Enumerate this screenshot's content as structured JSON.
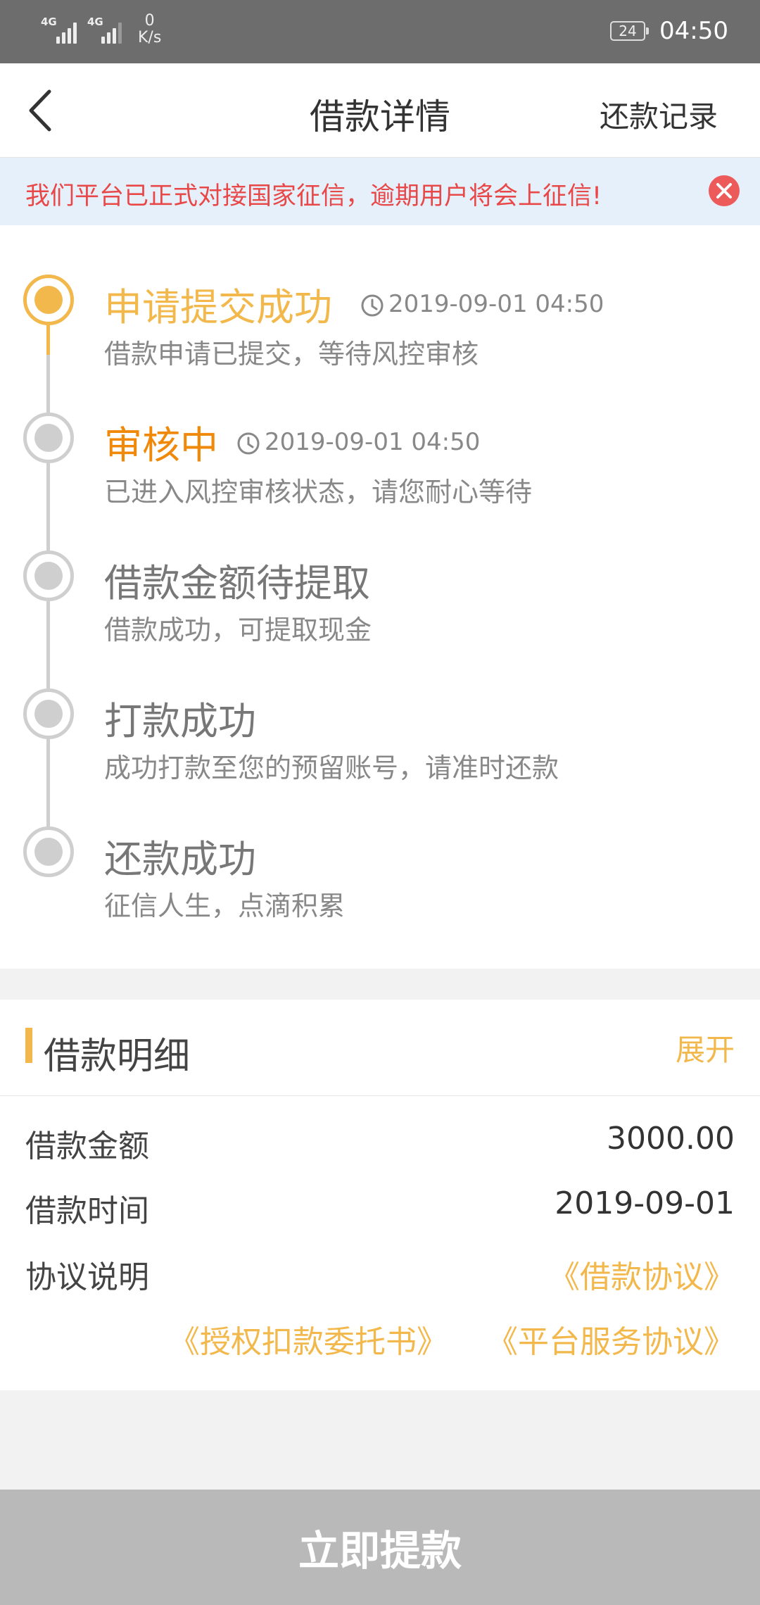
{
  "status_bar": {
    "sim1_tag": "4G",
    "sim2_tag": "4G",
    "net_speed_value": "0",
    "net_speed_unit": "K/s",
    "battery": "24",
    "time": "04:50"
  },
  "header": {
    "title": "借款详情",
    "right_link": "还款记录"
  },
  "notice": {
    "text": "我们平台已正式对接国家征信，逾期用户将会上征信!"
  },
  "timeline": {
    "steps": [
      {
        "title": "申请提交成功",
        "time": "2019-09-01 04:50",
        "desc": "借款申请已提交，等待风控审核"
      },
      {
        "title": "审核中",
        "time": "2019-09-01 04:50",
        "desc": "已进入风控审核状态，请您耐心等待"
      },
      {
        "title": "借款金额待提取",
        "time": "",
        "desc": "借款成功，可提取现金"
      },
      {
        "title": "打款成功",
        "time": "",
        "desc": "成功打款至您的预留账号，请准时还款"
      },
      {
        "title": "还款成功",
        "time": "",
        "desc": "征信人生，点滴积累"
      }
    ]
  },
  "loan_detail": {
    "title": "借款明细",
    "expand_label": "展开",
    "amount_label": "借款金额",
    "amount_value": "3000.00",
    "time_label": "借款时间",
    "time_value": "2019-09-01",
    "agreement_label": "协议说明",
    "agreement_loan": "《借款协议》",
    "agreement_authorization": "《授权扣款委托书》",
    "agreement_platform": "《平台服务协议》"
  },
  "actions": {
    "withdraw_label": "立即提款"
  },
  "colors": {
    "accent": "#f2b84b",
    "current": "#f0890a",
    "notice_text": "#e84848",
    "notice_bg": "#e5f0fb",
    "button_disabled": "#b9b9b9"
  }
}
